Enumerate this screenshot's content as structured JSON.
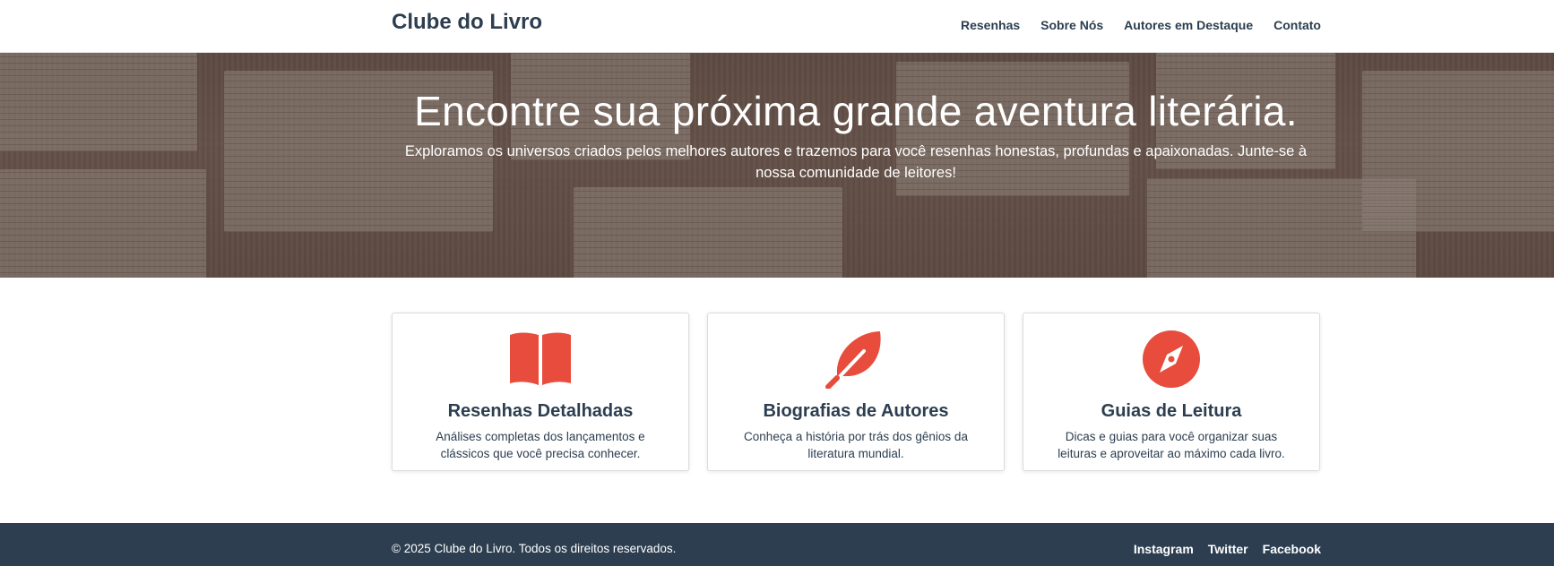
{
  "brand": "Clube do Livro",
  "nav": [
    "Resenhas",
    "Sobre Nós",
    "Autores em Destaque",
    "Contato"
  ],
  "hero": {
    "title": "Encontre sua próxima grande aventura literária.",
    "subtitle": "Exploramos os universos criados pelos melhores autores e trazemos para você resenhas honestas, profundas e apaixonadas. Junte-se à nossa comunidade de leitores!"
  },
  "features": [
    {
      "icon": "open-book-icon",
      "title": "Resenhas Detalhadas",
      "desc": "Análises completas dos lançamentos e clássicos que você precisa conhecer."
    },
    {
      "icon": "feather-icon",
      "title": "Biografias de Autores",
      "desc": "Conheça a história por trás dos gênios da literatura mundial."
    },
    {
      "icon": "compass-icon",
      "title": "Guias de Leitura",
      "desc": "Dicas e guias para você organizar suas leituras e aproveitar ao máximo cada livro."
    }
  ],
  "footer": {
    "copyright": "© 2025 Clube do Livro. Todos os direitos reservados.",
    "links": [
      "Instagram",
      "Twitter",
      "Facebook"
    ]
  },
  "colors": {
    "accent": "#e74c3c",
    "dark": "#2c3e50"
  }
}
